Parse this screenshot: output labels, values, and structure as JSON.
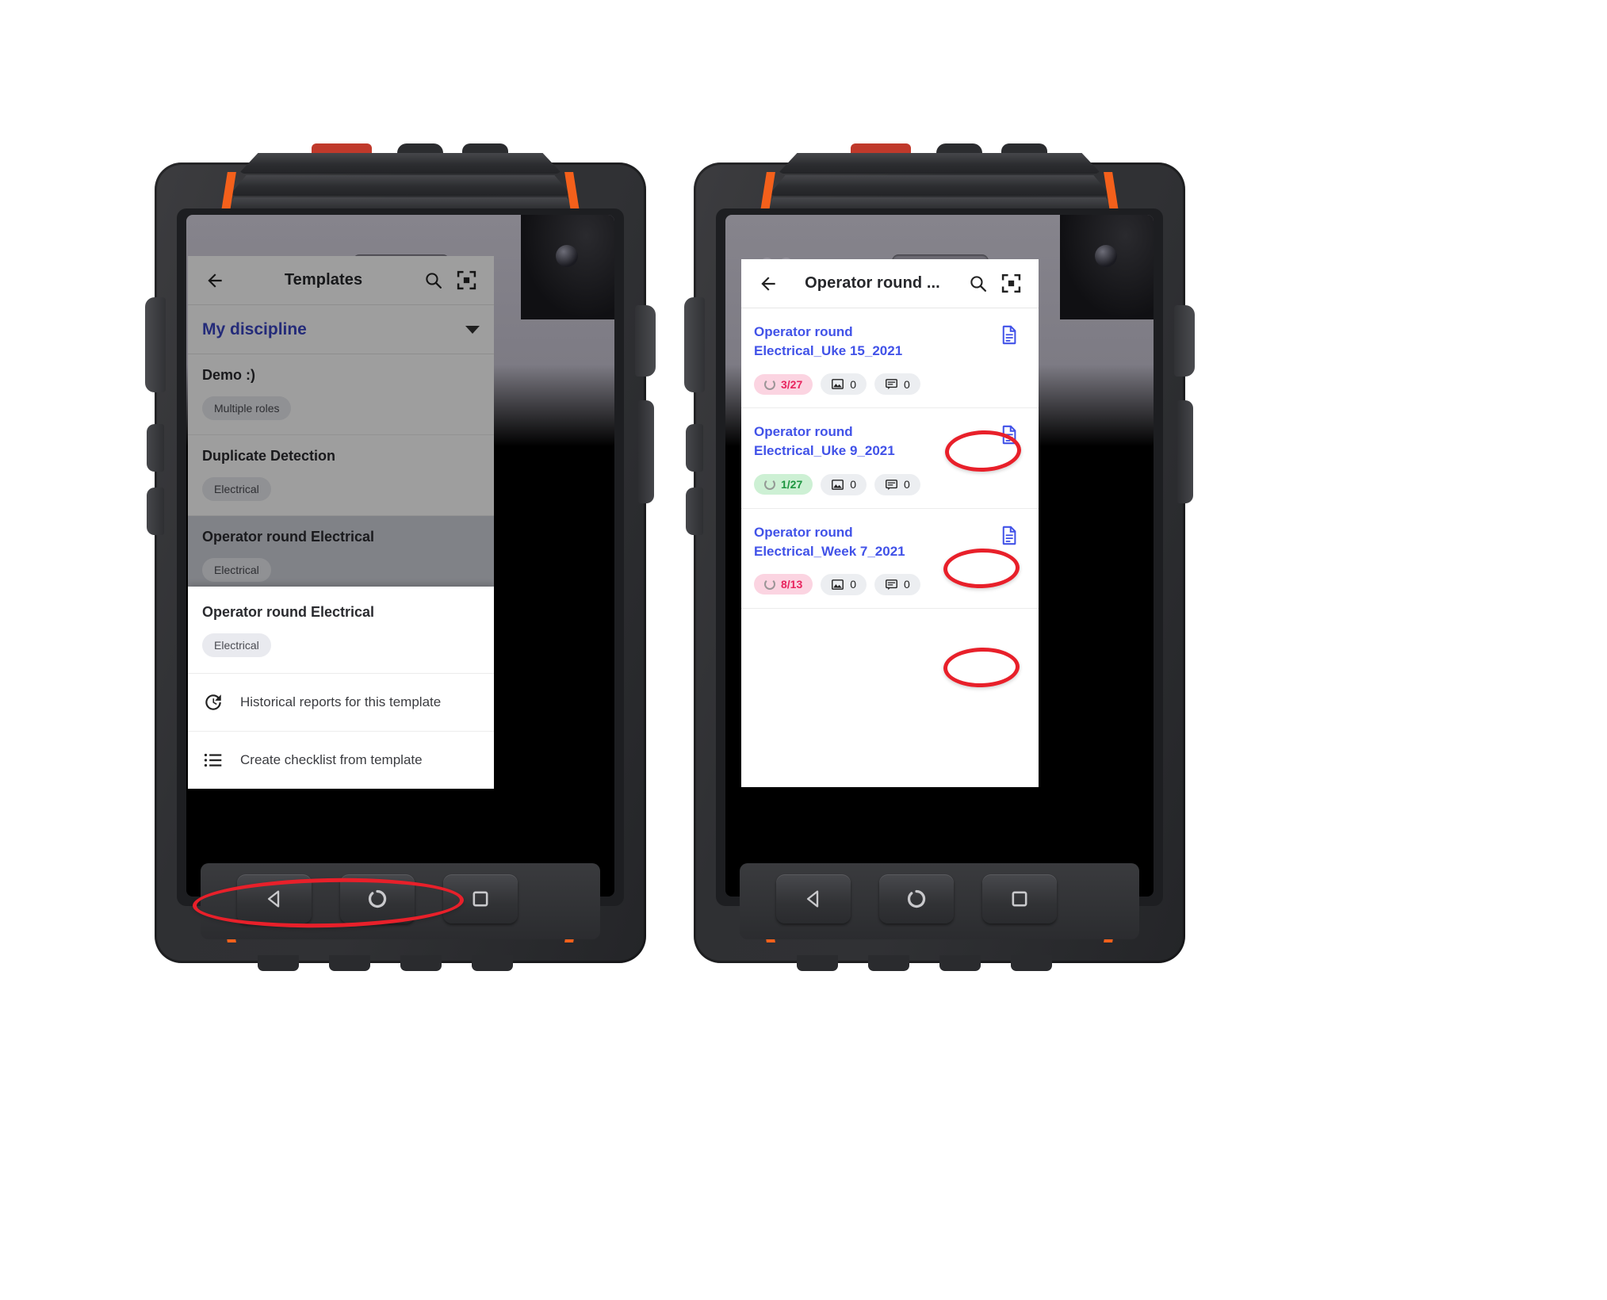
{
  "left_phone": {
    "appbar": {
      "title": "Templates",
      "back_icon": "arrow-left-icon",
      "search_icon": "search-icon",
      "scan_icon": "scan-icon"
    },
    "filter": {
      "label": "My discipline",
      "caret_icon": "chevron-down-icon"
    },
    "templates": [
      {
        "name": "Demo :)",
        "chip": "Multiple roles",
        "selected": false
      },
      {
        "name": "Duplicate Detection",
        "chip": "Electrical",
        "selected": false
      },
      {
        "name": "Operator round Electrical",
        "chip": "Electrical",
        "selected": true
      }
    ],
    "sheet": {
      "title": "Operator round Electrical",
      "chip": "Electrical",
      "items": [
        {
          "label": "Historical reports for this template",
          "icon": "history-icon",
          "highlighted": true
        },
        {
          "label": "Create checklist from template",
          "icon": "list-icon",
          "highlighted": false
        }
      ]
    },
    "navbar": {
      "back": "back-triangle-icon",
      "home": "home-circle-icon",
      "recents": "recents-square-icon"
    }
  },
  "right_phone": {
    "appbar": {
      "title": "Operator round ...",
      "back_icon": "arrow-left-icon",
      "search_icon": "search-icon",
      "scan_icon": "scan-icon"
    },
    "reports": [
      {
        "title": "Operator round Electrical_Uke 15_2021",
        "progress": "3/27",
        "progress_style": "pink",
        "photos": "0",
        "comments": "0",
        "doc_icon": "document-icon",
        "annotated": true
      },
      {
        "title": "Operator round Electrical_Uke 9_2021",
        "progress": "1/27",
        "progress_style": "green",
        "photos": "0",
        "comments": "0",
        "doc_icon": "document-icon",
        "annotated": true
      },
      {
        "title": "Operator round Electrical_Week 7_2021",
        "progress": "8/13",
        "progress_style": "pink",
        "photos": "0",
        "comments": "0",
        "doc_icon": "document-icon",
        "annotated": true
      }
    ],
    "navbar": {
      "back": "back-triangle-icon",
      "home": "home-circle-icon",
      "recents": "recents-square-icon"
    }
  },
  "colors": {
    "link_blue": "#4152e8",
    "filter_blue": "#3b46c4",
    "annotation_red": "#e8202a",
    "badge_pink_bg": "#fbd4e1",
    "badge_pink_text": "#e8245e",
    "badge_green_bg": "#cdf0d4",
    "badge_green_text": "#1d9640",
    "accent_orange": "#f4601b"
  }
}
